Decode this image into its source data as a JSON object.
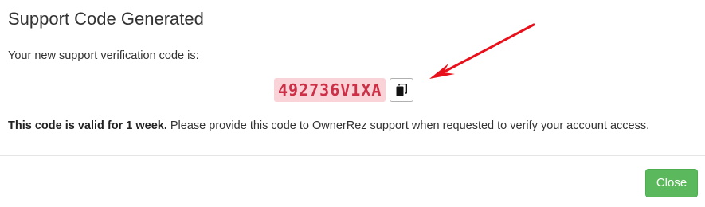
{
  "modal": {
    "title": "Support Code Generated",
    "intro": "Your new support verification code is:",
    "code": "492736V1XA",
    "copy_icon": "copy-icon",
    "validity_bold": "This code is valid for 1 week.",
    "validity_rest": " Please provide this code to OwnerRez support when requested to verify your account access.",
    "close_label": "Close"
  },
  "colors": {
    "code_text": "#cc2f46",
    "code_background": "#f9d3d8",
    "close_button": "#5cb85c",
    "annotation_arrow": "#e8101a"
  }
}
